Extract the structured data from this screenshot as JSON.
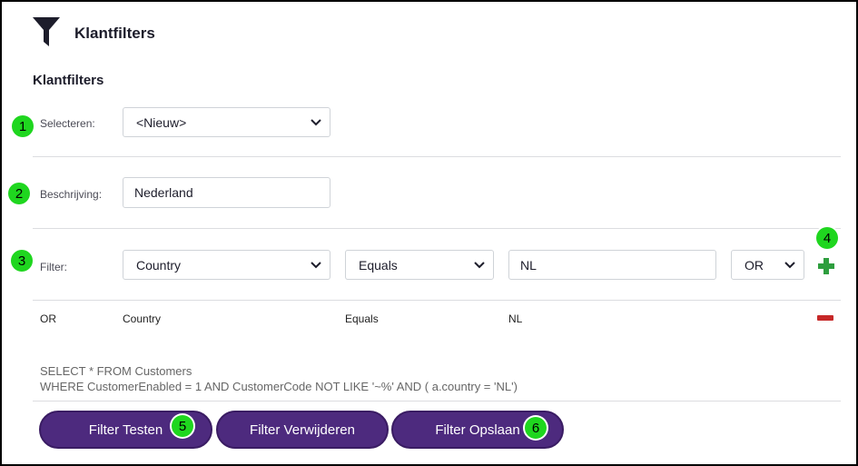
{
  "header": {
    "title": "Klantfilters",
    "icon": "filter-icon"
  },
  "section": {
    "title": "Klantfilters"
  },
  "form": {
    "select_label": "Selecteren:",
    "select_value": "<Nieuw>",
    "description_label": "Beschrijving:",
    "description_value": "Nederland",
    "filter_label": "Filter:",
    "field_value": "Country",
    "operator_value": "Equals",
    "filter_value": "NL",
    "logic_value": "OR"
  },
  "rows": [
    {
      "logic": "OR",
      "field": "Country",
      "operator": "Equals",
      "value": "NL"
    }
  ],
  "sql": {
    "line1": "SELECT * FROM Customers",
    "line2": "WHERE CustomerEnabled = 1 AND CustomerCode NOT LIKE '~%' AND ( a.country = 'NL')"
  },
  "buttons": {
    "test": "Filter Testen",
    "delete": "Filter Verwijderen",
    "save": "Filter Opslaan"
  },
  "badges": [
    "1",
    "2",
    "3",
    "4",
    "5",
    "6"
  ],
  "colors": {
    "accent": "#4d2a7e",
    "badge": "#1fd61f",
    "add": "#2e9e3e",
    "remove": "#c62828"
  }
}
